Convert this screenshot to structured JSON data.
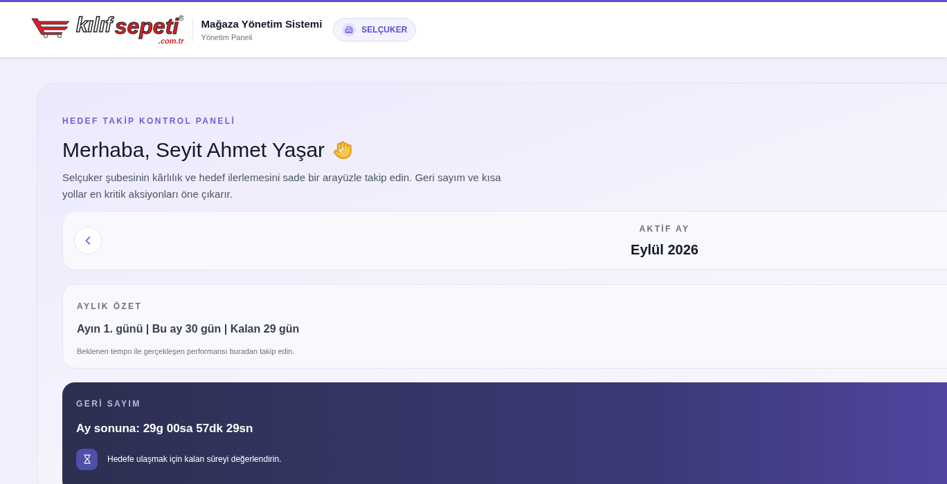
{
  "header": {
    "logo": {
      "word_1": "kılıf",
      "word_2": "sepeti",
      "registered": "®",
      "domain": ".com.tr"
    },
    "title": "Mağaza Yönetim Sistemi",
    "subtitle": "Yönetim Paneli",
    "store_badge": "SELÇUKER"
  },
  "hero": {
    "eyebrow": "HEDEF TAKİP KONTROL PANELİ",
    "greeting": "Merhaba, Seyit Ahmet Yaşar",
    "description": "Selçuker şubesinin kârlılık ve hedef ilerlemesini sade bir arayüzle takip edin. Geri sayım ve kısa yollar en kritik aksiyonları öne çıkarır."
  },
  "month_selector": {
    "label": "AKTİF AY",
    "value": "Eylül 2026"
  },
  "summary": {
    "label": "AYLIK ÖZET",
    "headline": "Ayın 1. günü | Bu ay 30 gün | Kalan 29 gün",
    "note": "Beklenen tempo ile gerçekleşen performansı buradan takip edin."
  },
  "countdown": {
    "label": "GERİ SAYIM",
    "value": "Ay sonuna: 29g 00sa 57dk 29sn",
    "hint": "Hedefe ulaşmak için kalan süreyi değerlendirin."
  }
}
